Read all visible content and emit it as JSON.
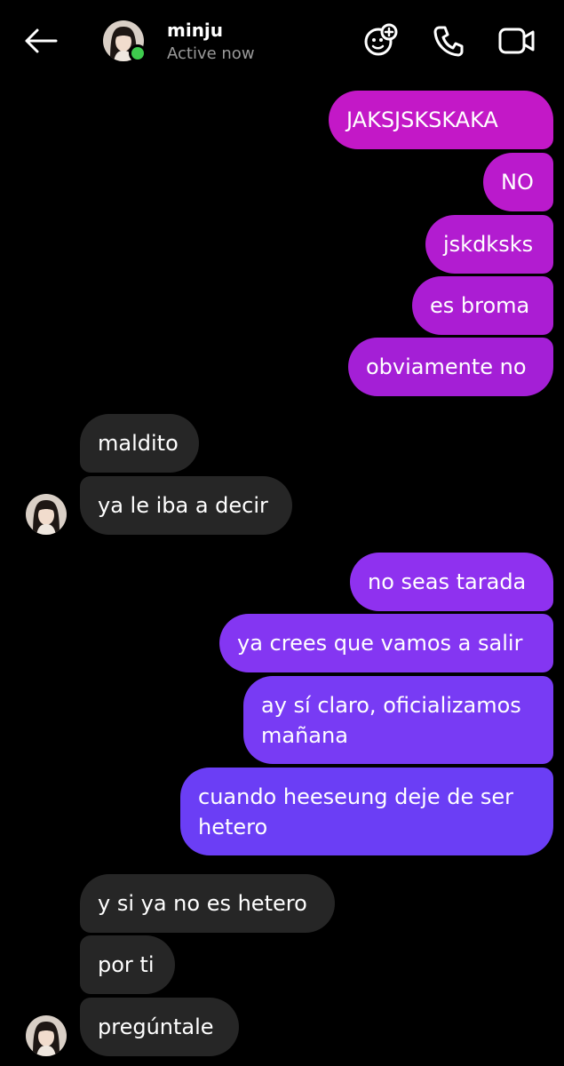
{
  "header": {
    "name": "minju",
    "status": "Active now",
    "icons": [
      "back-arrow-icon",
      "effects-icon",
      "phone-icon",
      "video-icon"
    ],
    "online_color": "#3ecb4d"
  },
  "messages": {
    "m1": "JAKSJSKSKAKA",
    "m2": "NO",
    "m3": "jskdksks",
    "m4": "es broma",
    "m5": "obviamente no",
    "m6": "maldito",
    "m7": "ya le iba a decir",
    "m8": "no seas tarada",
    "m9": "ya crees que vamos a salir",
    "m10": "ay sí claro, oficializamos mañana",
    "m11": "cuando heeseung deje de ser hetero",
    "m12": "y si ya no es hetero",
    "m13": "por ti",
    "m14": "pregúntale"
  },
  "colors": {
    "incoming_bubble": "#262626",
    "outgoing_gradient_top": "#c318c7",
    "outgoing_gradient_bottom": "#6b3ef5"
  }
}
